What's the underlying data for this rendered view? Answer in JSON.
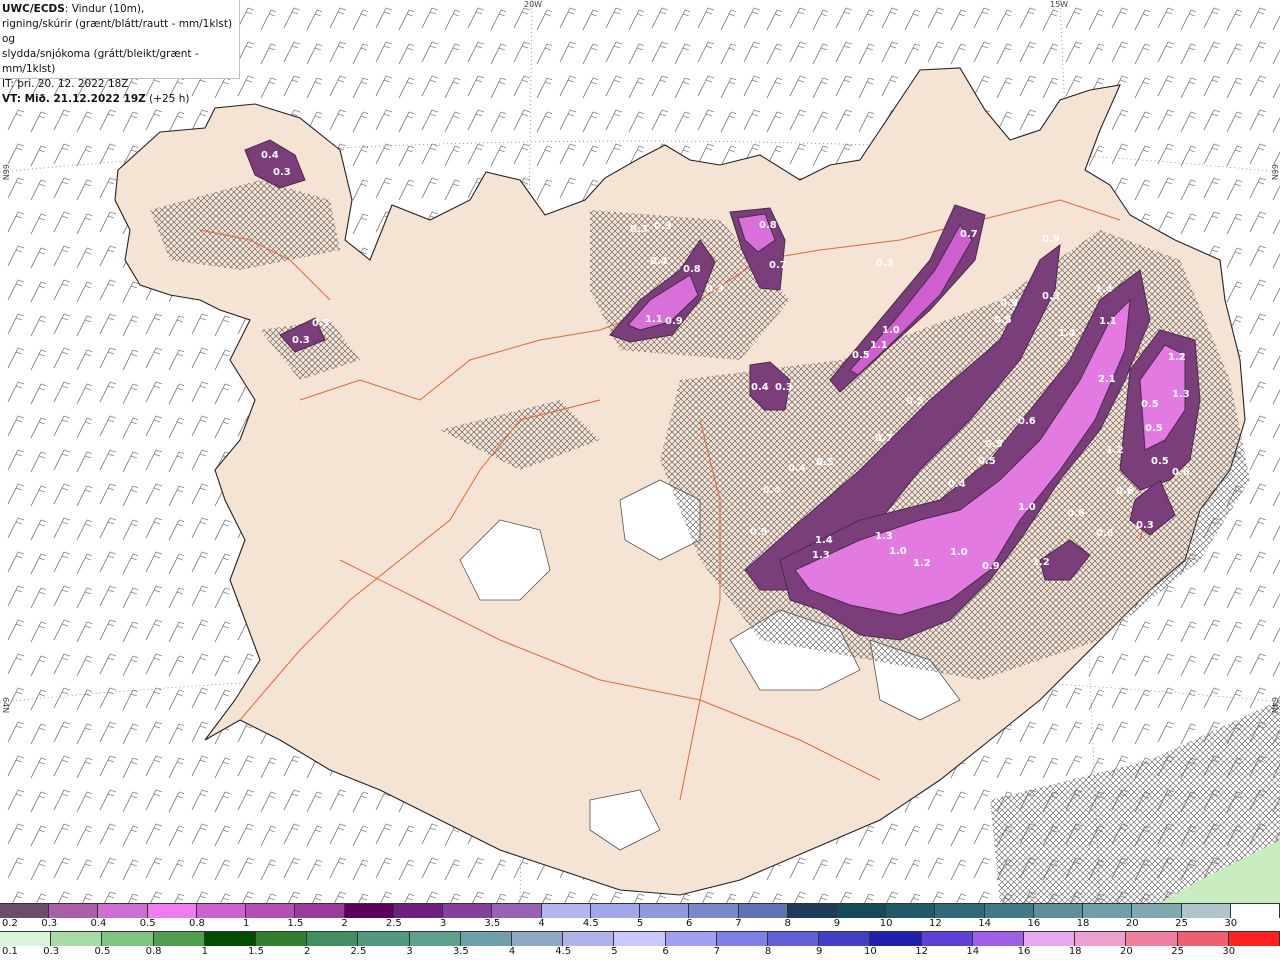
{
  "info": {
    "line1_bold": "UWC/ECDS",
    "line1_rest": ": Vindur (10m),",
    "line2": "rigning/skúrir (grænt/blátt/rautt - mm/1klst) og",
    "line3": "slydda/snjókoma (grátt/bleikt/grænt - mm/1klst)",
    "line4": "IT: þri. 20. 12. 2022 18Z",
    "line5_bold": "VT: Mið. 21.12.2022 19Z",
    "line5_rest": " (+25 h)"
  },
  "grid_labels": {
    "top_20w": "20W",
    "top_15w": "15W",
    "left_66n": "66N",
    "right_66n": "66N",
    "left_64n": "64N",
    "right_64n": "64N"
  },
  "precip_values": [
    "0.4",
    "0.3",
    "0.3",
    "0.3",
    "0.3",
    "0.3",
    "0.4",
    "0.8",
    "0.3",
    "1.1",
    "0.9",
    "0.8",
    "0.7",
    "0.7",
    "0.9",
    "0.9",
    "0.5",
    "0.3",
    "1.4",
    "1.1",
    "1.4",
    "0.5",
    "1.1",
    "0.3",
    "1.0",
    "0.4",
    "0.3",
    "2.1",
    "1.2",
    "1.3",
    "0.5",
    "0.5",
    "0.5",
    "0.7",
    "0.6",
    "0.5",
    "0.5",
    "1.2",
    "0.5",
    "0.6",
    "0.4",
    "0.5",
    "0.4",
    "0.6",
    "0.4",
    "1.0",
    "0.6",
    "0.3",
    "0.5",
    "1.4",
    "1.3",
    "1.3",
    "1.0",
    "1.2",
    "1.0",
    "0.9",
    "1.2",
    "0.6"
  ],
  "legend_snow": {
    "labels": [
      "0.2",
      "0.3",
      "0.4",
      "0.5",
      "0.8",
      "1",
      "1.5",
      "2",
      "2.5",
      "3",
      "3.5",
      "4",
      "4.5",
      "5",
      "6",
      "7",
      "8",
      "9",
      "10",
      "12",
      "14",
      "16",
      "18",
      "20",
      "25",
      "30"
    ],
    "colors": [
      "#6b4d6b",
      "#a85fa8",
      "#cc6fd0",
      "#f07cf0",
      "#cf5fcf",
      "#b44fb4",
      "#9a3a9a",
      "#5c005c",
      "#6f1f7f",
      "#84409a",
      "#9a62b4",
      "#b4b4f0",
      "#a0a8e8",
      "#8f9ad8",
      "#7789c9",
      "#5f74b4",
      "#203a5a",
      "#174a58",
      "#1f5a68",
      "#2f6a78",
      "#3f7a88",
      "#5f8f9a",
      "#6f9fa8",
      "#7fa8b0",
      "#afc4cc",
      "#ffffff"
    ]
  },
  "legend_rain": {
    "labels": [
      "0.1",
      "0.3",
      "0.5",
      "0.8",
      "1",
      "1.5",
      "2",
      "2.5",
      "3",
      "3.5",
      "4",
      "4.5",
      "5",
      "6",
      "7",
      "8",
      "9",
      "10",
      "12",
      "14",
      "16",
      "18",
      "20",
      "25",
      "30"
    ],
    "colors": [
      "#d9f5d9",
      "#a6dca6",
      "#7fc47f",
      "#4f9f4f",
      "#004f00",
      "#2f7f2f",
      "#3f8f5f",
      "#4f9a7f",
      "#5fa08f",
      "#6f9fa8",
      "#8fa8c4",
      "#aeb4e8",
      "#c8c8ff",
      "#a0a0f0",
      "#7f7fe8",
      "#5f5fd8",
      "#3f3fc8",
      "#1f1fb0",
      "#5f3fd8",
      "#9f5fe8",
      "#e8a8f0",
      "#f0a0d0",
      "#f07fa0",
      "#f05f6f",
      "#ff2020"
    ]
  }
}
